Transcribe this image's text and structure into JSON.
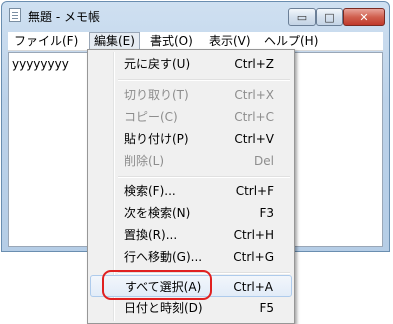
{
  "window": {
    "title": "無題 - メモ帳",
    "buttons": {
      "minimize": "▭",
      "maximize": "□",
      "close": "✕"
    }
  },
  "menubar": {
    "file": "ファイル(F)",
    "edit": "編集(E)",
    "format": "書式(O)",
    "view": "表示(V)",
    "help": "ヘルプ(H)"
  },
  "editor": {
    "text": "yyyyyyyy"
  },
  "edit_menu": {
    "items": [
      {
        "label": "元に戻す(U)",
        "shortcut": "Ctrl+Z"
      },
      {
        "label": "切り取り(T)",
        "shortcut": "Ctrl+X"
      },
      {
        "label": "コピー(C)",
        "shortcut": "Ctrl+C"
      },
      {
        "label": "貼り付け(P)",
        "shortcut": "Ctrl+V"
      },
      {
        "label": "削除(L)",
        "shortcut": "Del"
      },
      {
        "label": "検索(F)...",
        "shortcut": "Ctrl+F"
      },
      {
        "label": "次を検索(N)",
        "shortcut": "F3"
      },
      {
        "label": "置換(R)...",
        "shortcut": "Ctrl+H"
      },
      {
        "label": "行へ移動(G)...",
        "shortcut": "Ctrl+G"
      },
      {
        "label": "すべて選択(A)",
        "shortcut": "Ctrl+A"
      },
      {
        "label": "日付と時刻(D)",
        "shortcut": "F5"
      }
    ]
  },
  "colors": {
    "highlight_circle": "#e02020",
    "disabled_text": "#8d8d8d"
  }
}
